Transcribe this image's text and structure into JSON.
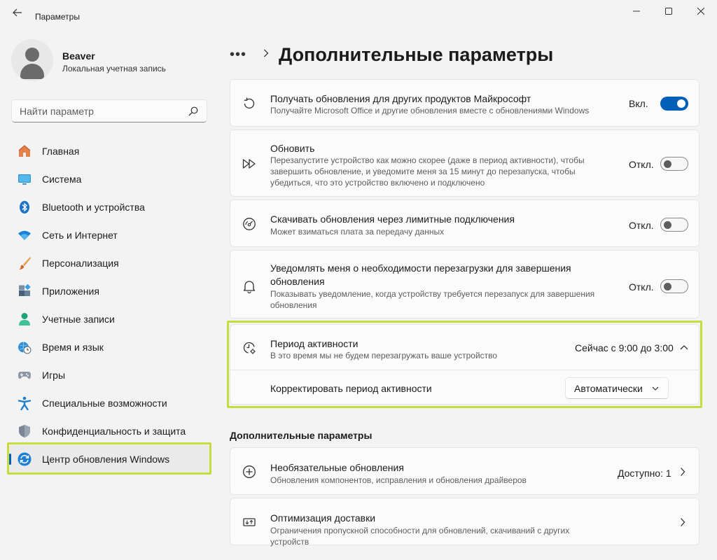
{
  "window": {
    "title": "Параметры"
  },
  "user": {
    "name": "Beaver",
    "account_type": "Локальная учетная запись"
  },
  "search": {
    "placeholder": "Найти параметр",
    "value": ""
  },
  "sidebar": {
    "items": [
      {
        "label": "Главная",
        "icon": "home-icon"
      },
      {
        "label": "Система",
        "icon": "display-icon"
      },
      {
        "label": "Bluetooth и устройства",
        "icon": "bluetooth-icon"
      },
      {
        "label": "Сеть и Интернет",
        "icon": "wifi-icon"
      },
      {
        "label": "Персонализация",
        "icon": "brush-icon"
      },
      {
        "label": "Приложения",
        "icon": "apps-icon"
      },
      {
        "label": "Учетные записи",
        "icon": "person-icon"
      },
      {
        "label": "Время и язык",
        "icon": "globe-clock-icon"
      },
      {
        "label": "Игры",
        "icon": "gamepad-icon"
      },
      {
        "label": "Специальные возможности",
        "icon": "accessibility-icon"
      },
      {
        "label": "Конфиденциальность и защита",
        "icon": "shield-icon"
      },
      {
        "label": "Центр обновления Windows",
        "icon": "windows-update-icon",
        "active": true
      }
    ]
  },
  "breadcrumb": {
    "overflow": "•••",
    "title": "Дополнительные параметры"
  },
  "settings": [
    {
      "title": "Получать обновления для других продуктов Майкрософт",
      "description": "Получайте Microsoft Office и другие обновления вместе с обновлениями Windows",
      "state_label": "Вкл.",
      "on": true,
      "icon": "history-icon"
    },
    {
      "title": "Обновить",
      "description": "Перезапустите устройство как можно скорее (даже в период активности), чтобы завершить обновление, и уведомите меня за 15 минут до перезапуска, чтобы убедиться, что это устройство включено и подключено",
      "state_label": "Откл.",
      "on": false,
      "icon": "fast-forward-icon"
    },
    {
      "title": "Скачивать обновления через лимитные подключения",
      "description": "Может взиматься плата за передачу данных",
      "state_label": "Откл.",
      "on": false,
      "icon": "speedometer-icon"
    },
    {
      "title": "Уведомлять меня о необходимости перезагрузки для завершения обновления",
      "description": "Показывать уведомление, когда устройству требуется перезапуск для завершения обновления",
      "state_label": "Откл.",
      "on": false,
      "icon": "bell-icon"
    }
  ],
  "active_hours": {
    "title": "Период активности",
    "description": "В это время мы не будем перезагружать ваше устройство",
    "value": "Сейчас с 9:00 до 3:00",
    "adjust_label": "Корректировать период активности",
    "adjust_value": "Автоматически"
  },
  "section_title": "Дополнительные параметры",
  "additional": [
    {
      "title": "Необязательные обновления",
      "description": "Обновления компонентов, исправления и обновления драйверов",
      "badge": "Доступно: 1",
      "icon": "plus-circle-icon"
    },
    {
      "title": "Оптимизация доставки",
      "description": "Ограничения пропускной способности для обновлений, скачиваний с других устройств",
      "badge": "",
      "icon": "delivery-optimization-icon"
    }
  ],
  "colors": {
    "accent": "#005fb8",
    "highlight": "#c7dd3f",
    "background": "#f3f3f3",
    "card": "#fbfbfb"
  }
}
